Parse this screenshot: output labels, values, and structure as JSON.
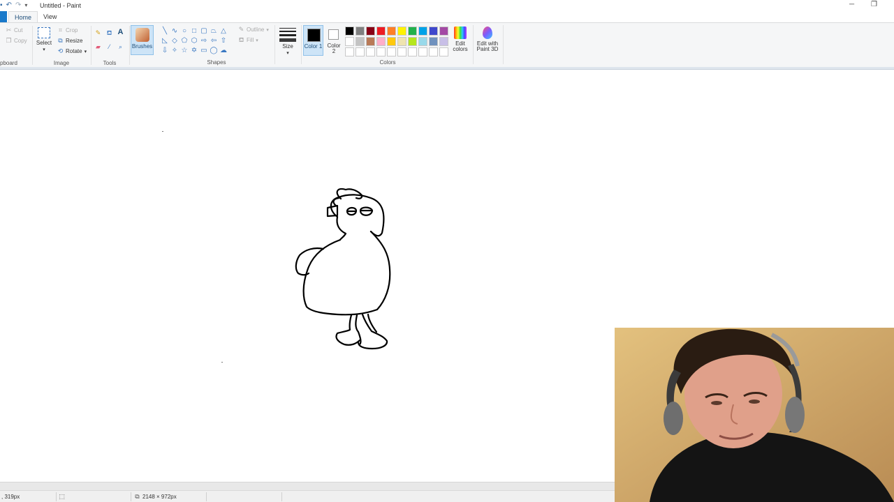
{
  "window": {
    "title": "Untitled - Paint"
  },
  "tabs": [
    {
      "label": "Home"
    },
    {
      "label": "View"
    }
  ],
  "ribbon": {
    "clipboard": {
      "group_label": "pboard",
      "cut": "Cut",
      "copy": "Copy"
    },
    "image": {
      "group_label": "Image",
      "select": "Select",
      "crop": "Crop",
      "resize": "Resize",
      "rotate": "Rotate"
    },
    "tools": {
      "group_label": "Tools"
    },
    "brushes": {
      "label": "Brushes"
    },
    "shapes": {
      "group_label": "Shapes",
      "outline": "Outline",
      "fill": "Fill"
    },
    "size": {
      "label": "Size"
    },
    "colors": {
      "group_label": "Colors",
      "color1_label": "Color 1",
      "color2_label": "Color 2",
      "color1_value": "#000000",
      "color2_value": "#ffffff",
      "edit_colors": "Edit colors",
      "palette": [
        "#000000",
        "#7f7f7f",
        "#880015",
        "#ed1c24",
        "#ff7f27",
        "#fff200",
        "#22b14c",
        "#00a2e8",
        "#3f48cc",
        "#a349a4",
        "#ffffff",
        "#c3c3c3",
        "#b97a57",
        "#ffaec9",
        "#ffc90e",
        "#efe4b0",
        "#b5e61d",
        "#99d9ea",
        "#7092be",
        "#c8bfe7",
        "#ffffff",
        "#ffffff",
        "#ffffff",
        "#ffffff",
        "#ffffff",
        "#ffffff",
        "#ffffff",
        "#ffffff",
        "#ffffff",
        "#ffffff"
      ]
    },
    "paint3d": {
      "label": "Edit with Paint 3D"
    }
  },
  "status": {
    "cursor_position": ", 319px",
    "canvas_size": "2148 × 972px"
  },
  "icons": {
    "cut": "scissors-icon",
    "copy": "copy-icon",
    "crop": "crop-icon",
    "resize": "resize-icon",
    "rotate": "rotate-icon",
    "pencil": "pencil-icon",
    "fill": "fill-bucket-icon",
    "text": "text-icon",
    "eraser": "eraser-icon",
    "picker": "color-picker-icon",
    "magnifier": "magnifier-icon"
  }
}
